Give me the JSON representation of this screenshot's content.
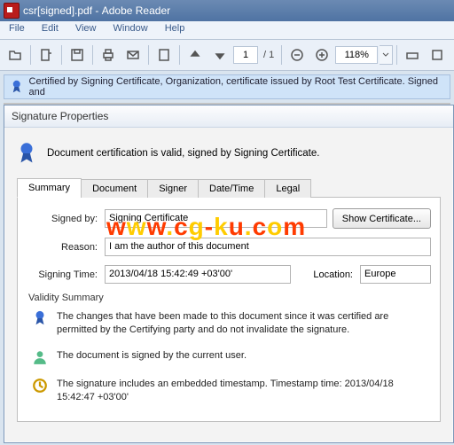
{
  "titlebar": {
    "document": "csr[signed].pdf",
    "app": "Adobe Reader"
  },
  "menu": {
    "file": "File",
    "edit": "Edit",
    "view": "View",
    "window": "Window",
    "help": "Help"
  },
  "toolbar": {
    "page_current": "1",
    "page_total": "/ 1",
    "zoom": "118%"
  },
  "certbar": {
    "text": "Certified by Signing Certificate, Organization, certificate issued by Root Test Certificate. Signed and"
  },
  "dialog": {
    "title": "Signature Properties",
    "cert_message": "Document certification is valid, signed by Signing Certificate.",
    "tabs": {
      "summary": "Summary",
      "document": "Document",
      "signer": "Signer",
      "datetime": "Date/Time",
      "legal": "Legal"
    },
    "signed_by_label": "Signed by:",
    "signed_by_value": "Signing Certificate",
    "show_cert_btn": "Show Certificate...",
    "reason_label": "Reason:",
    "reason_value": "I am the author of this document",
    "signing_time_label": "Signing Time:",
    "signing_time_value": "2013/04/18 15:42:49 +03'00'",
    "location_label": "Location:",
    "location_value": "Europe",
    "validity_title": "Validity Summary",
    "validity_items": [
      "The changes that have been made to this document since it was certified are permitted by the Certifying party and do not invalidate the signature.",
      "The document is signed by the current user.",
      "The signature includes an embedded timestamp. Timestamp time: 2013/04/18 15:42:47 +03'00'"
    ]
  },
  "watermark": "www.cg-ku.com"
}
